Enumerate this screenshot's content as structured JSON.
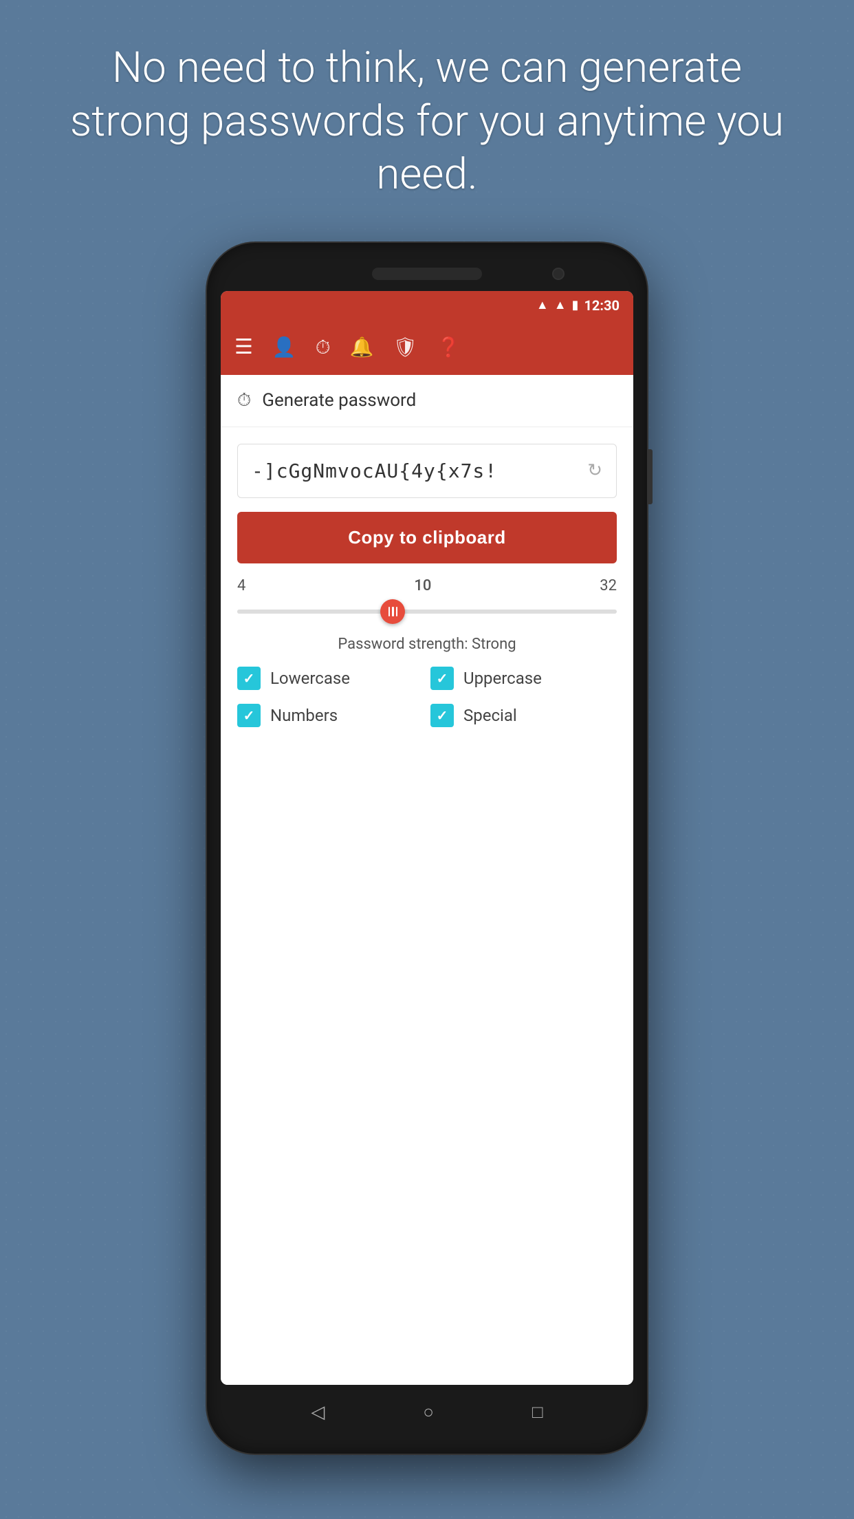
{
  "background": {
    "color": "#5a7a9a"
  },
  "hero": {
    "text": "No need to think, we can generate strong passwords for you anytime you need."
  },
  "status_bar": {
    "time": "12:30"
  },
  "toolbar": {
    "icons": [
      "menu",
      "person",
      "timer",
      "alarm",
      "shield",
      "help"
    ]
  },
  "section": {
    "icon": "⏱",
    "title": "Generate password"
  },
  "password": {
    "value": "-]cGgNmvocAU{4y{x7s!",
    "refresh_icon": "↻"
  },
  "copy_button": {
    "label": "Copy to clipboard"
  },
  "slider": {
    "min": "4",
    "value": "10",
    "max": "32",
    "strength_label": "Password strength: Strong"
  },
  "checkboxes": [
    {
      "label": "Lowercase",
      "checked": true
    },
    {
      "label": "Uppercase",
      "checked": true
    },
    {
      "label": "Numbers",
      "checked": true
    },
    {
      "label": "Special",
      "checked": true
    }
  ]
}
